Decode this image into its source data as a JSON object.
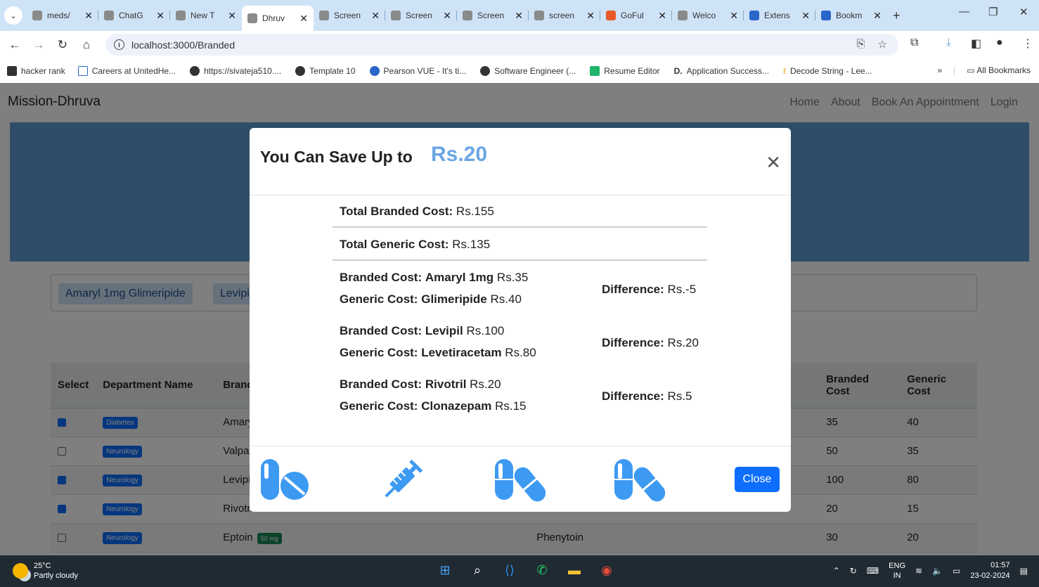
{
  "browser": {
    "tabs": [
      {
        "label": "meds/",
        "active": false
      },
      {
        "label": "ChatG",
        "active": false
      },
      {
        "label": "New T",
        "active": false
      },
      {
        "label": "Dhruv",
        "active": true
      },
      {
        "label": "Screen",
        "active": false
      },
      {
        "label": "Screen",
        "active": false
      },
      {
        "label": "Screen",
        "active": false
      },
      {
        "label": "screen",
        "active": false
      },
      {
        "label": "GoFul",
        "active": false
      },
      {
        "label": "Welco",
        "active": false
      },
      {
        "label": "Extens",
        "active": false
      },
      {
        "label": "Bookm",
        "active": false
      }
    ],
    "url": "localhost:3000/Branded",
    "bookmarks": [
      "hacker rank",
      "Careers at UnitedHe...",
      "https://sivateja510....",
      "Template 10",
      "Pearson VUE - It's ti...",
      "Software Engineer (...",
      "Resume Editor",
      "Application Success...",
      "Decode String - Lee..."
    ],
    "all_bookmarks": "All Bookmarks"
  },
  "site": {
    "brand": "Mission-Dhruva",
    "nav": [
      "Home",
      "About",
      "Book An Appointment",
      "Login"
    ],
    "chips": [
      "Amaryl 1mg  Glimeripide",
      "Levipi"
    ],
    "table": {
      "headers": [
        "Select",
        "Department Name",
        "Brand",
        "Branded Cost",
        "Generic Cost"
      ],
      "rows": [
        {
          "checked": true,
          "dept": "Diabetes",
          "brand": "Amary",
          "dose": "",
          "generic": "",
          "branded": "35",
          "generic_cost": "40"
        },
        {
          "checked": false,
          "dept": "Neurology",
          "brand": "Valpar",
          "dose": "",
          "generic": "",
          "branded": "50",
          "generic_cost": "35"
        },
        {
          "checked": true,
          "dept": "Neurology",
          "brand": "Levipil",
          "dose": "",
          "generic": "",
          "branded": "100",
          "generic_cost": "80"
        },
        {
          "checked": true,
          "dept": "Neurology",
          "brand": "Rivotri",
          "dose": "",
          "generic": "",
          "branded": "20",
          "generic_cost": "15"
        },
        {
          "checked": false,
          "dept": "Neurology",
          "brand": "Eptoin",
          "dose": "50 mg",
          "generic": "Phenytoin",
          "branded": "30",
          "generic_cost": "20"
        }
      ]
    }
  },
  "modal": {
    "title": "You Can Save Up to",
    "amount": "Rs.20",
    "total_branded_label": "Total Branded Cost:",
    "total_branded_value": "Rs.155",
    "total_generic_label": "Total Generic Cost:",
    "total_generic_value": "Rs.135",
    "items": [
      {
        "branded_label": "Branded Cost:",
        "branded_name": "Amaryl 1mg",
        "branded_cost": "Rs.35",
        "generic_label": "Generic Cost:",
        "generic_name": "Glimeripide",
        "generic_cost": "Rs.40",
        "diff_label": "Difference:",
        "diff_value": "Rs.-5"
      },
      {
        "branded_label": "Branded Cost:",
        "branded_name": "Levipil",
        "branded_cost": "Rs.100",
        "generic_label": "Generic Cost:",
        "generic_name": "Levetiracetam",
        "generic_cost": "Rs.80",
        "diff_label": "Difference:",
        "diff_value": "Rs.20"
      },
      {
        "branded_label": "Branded Cost:",
        "branded_name": "Rivotril",
        "branded_cost": "Rs.20",
        "generic_label": "Generic Cost:",
        "generic_name": "Clonazepam",
        "generic_cost": "Rs.15",
        "diff_label": "Difference:",
        "diff_value": "Rs.5"
      }
    ],
    "close_label": "Close",
    "footer_icons": [
      "pills-icon",
      "syringe-icon",
      "capsules-icon",
      "capsules-icon"
    ]
  },
  "taskbar": {
    "temp": "25°C",
    "weather": "Partly cloudy",
    "lang1": "ENG",
    "lang2": "IN",
    "time": "01:57",
    "date": "23-02-2024"
  },
  "colors": {
    "accent": "#0d6efd",
    "amount": "#6aa6e4",
    "hero": "#5f9bd0",
    "footer_icon": "#3d9af2"
  }
}
